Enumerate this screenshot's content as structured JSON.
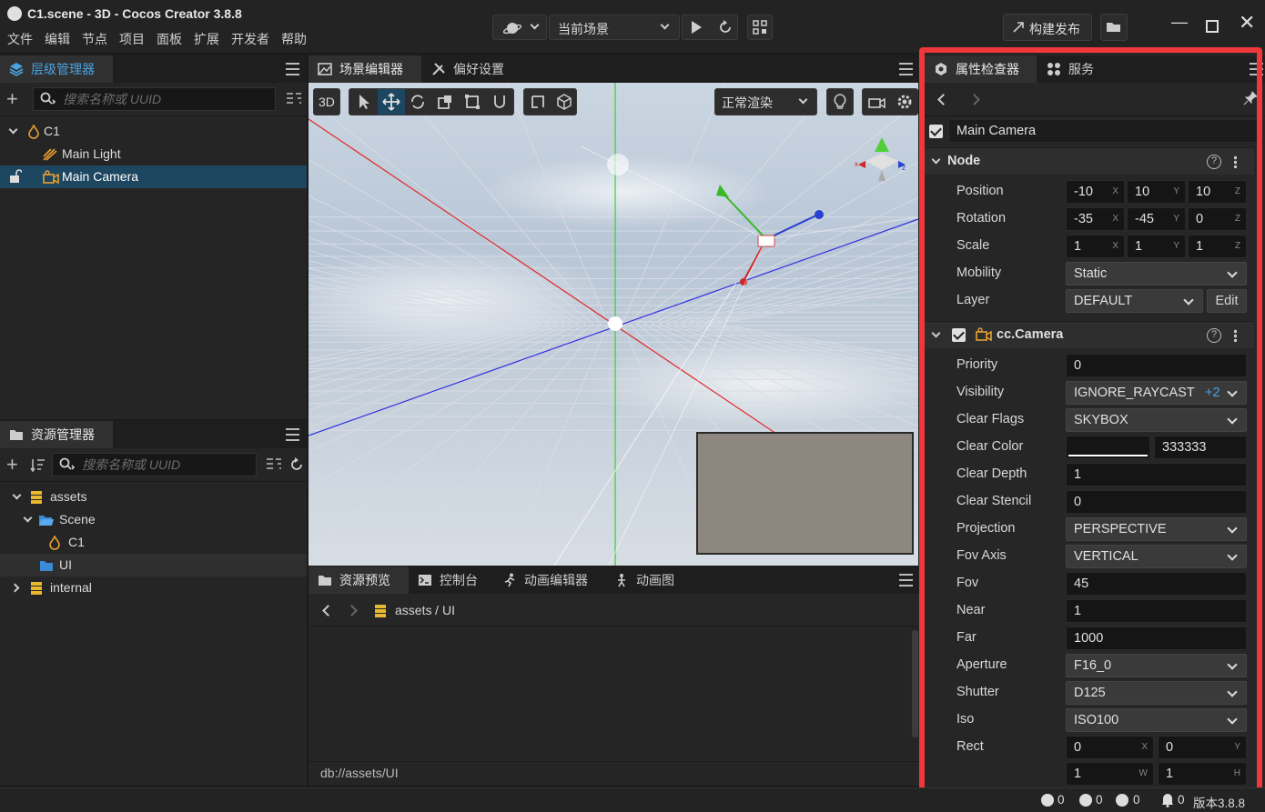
{
  "window": {
    "title": "C1.scene - 3D - Cocos Creator 3.8.8"
  },
  "menu": [
    "文件",
    "编辑",
    "节点",
    "项目",
    "面板",
    "扩展",
    "开发者",
    "帮助"
  ],
  "toolbar": {
    "scene_select": "当前场景",
    "build_label": "构建发布"
  },
  "hierarchy": {
    "tab_label": "层级管理器",
    "search_placeholder": "搜索名称或 UUID",
    "items": [
      {
        "label": "C1"
      },
      {
        "label": "Main Light"
      },
      {
        "label": "Main Camera"
      }
    ]
  },
  "assets": {
    "tab_label": "资源管理器",
    "search_placeholder": "搜索名称或 UUID",
    "items": [
      {
        "label": "assets"
      },
      {
        "label": "Scene"
      },
      {
        "label": "C1"
      },
      {
        "label": "UI"
      },
      {
        "label": "internal"
      }
    ]
  },
  "scene_editor": {
    "tabs": [
      "场景编辑器",
      "偏好设置"
    ],
    "mode_3d": "3D",
    "render_mode": "正常渲染"
  },
  "bottom": {
    "tabs": [
      "资源预览",
      "控制台",
      "动画编辑器",
      "动画图"
    ],
    "path_root": "assets",
    "path_sep": "/",
    "path_leaf": "UI",
    "db_path": "db://assets/UI"
  },
  "inspector": {
    "tabs": [
      "属性检查器",
      "服务"
    ],
    "node_name": "Main Camera",
    "node_section": {
      "title": "Node",
      "position": {
        "label": "Position",
        "x": "-10",
        "y": "10",
        "z": "10"
      },
      "rotation": {
        "label": "Rotation",
        "x": "-35",
        "y": "-45",
        "z": "0"
      },
      "scale": {
        "label": "Scale",
        "x": "1",
        "y": "1",
        "z": "1"
      },
      "mobility": {
        "label": "Mobility",
        "value": "Static"
      },
      "layer": {
        "label": "Layer",
        "value": "DEFAULT",
        "edit_label": "Edit"
      }
    },
    "camera_section": {
      "title": "cc.Camera",
      "priority": {
        "label": "Priority",
        "value": "0"
      },
      "visibility": {
        "label": "Visibility",
        "value": "IGNORE_RAYCAST",
        "extra": "+2"
      },
      "clear_flags": {
        "label": "Clear Flags",
        "value": "SKYBOX"
      },
      "clear_color": {
        "label": "Clear Color",
        "hex": "333333"
      },
      "clear_depth": {
        "label": "Clear Depth",
        "value": "1"
      },
      "clear_stencil": {
        "label": "Clear Stencil",
        "value": "0"
      },
      "projection": {
        "label": "Projection",
        "value": "PERSPECTIVE"
      },
      "fov_axis": {
        "label": "Fov Axis",
        "value": "VERTICAL"
      },
      "fov": {
        "label": "Fov",
        "value": "45"
      },
      "near": {
        "label": "Near",
        "value": "1"
      },
      "far": {
        "label": "Far",
        "value": "1000"
      },
      "aperture": {
        "label": "Aperture",
        "value": "F16_0"
      },
      "shutter": {
        "label": "Shutter",
        "value": "D125"
      },
      "iso": {
        "label": "Iso",
        "value": "ISO100"
      },
      "rect": {
        "label": "Rect",
        "x": "0",
        "y": "0",
        "w": "1",
        "h": "1"
      }
    },
    "axis_labels": {
      "x": "X",
      "y": "Y",
      "z": "Z",
      "w": "W",
      "h": "H"
    }
  },
  "status": {
    "info": "0",
    "warn": "0",
    "error": "0",
    "notice": "0",
    "version": "版本3.8.8"
  },
  "colors": {
    "accent": "#4aa3e0",
    "highlight_box": "#f0373c",
    "selection": "#1d4760"
  }
}
